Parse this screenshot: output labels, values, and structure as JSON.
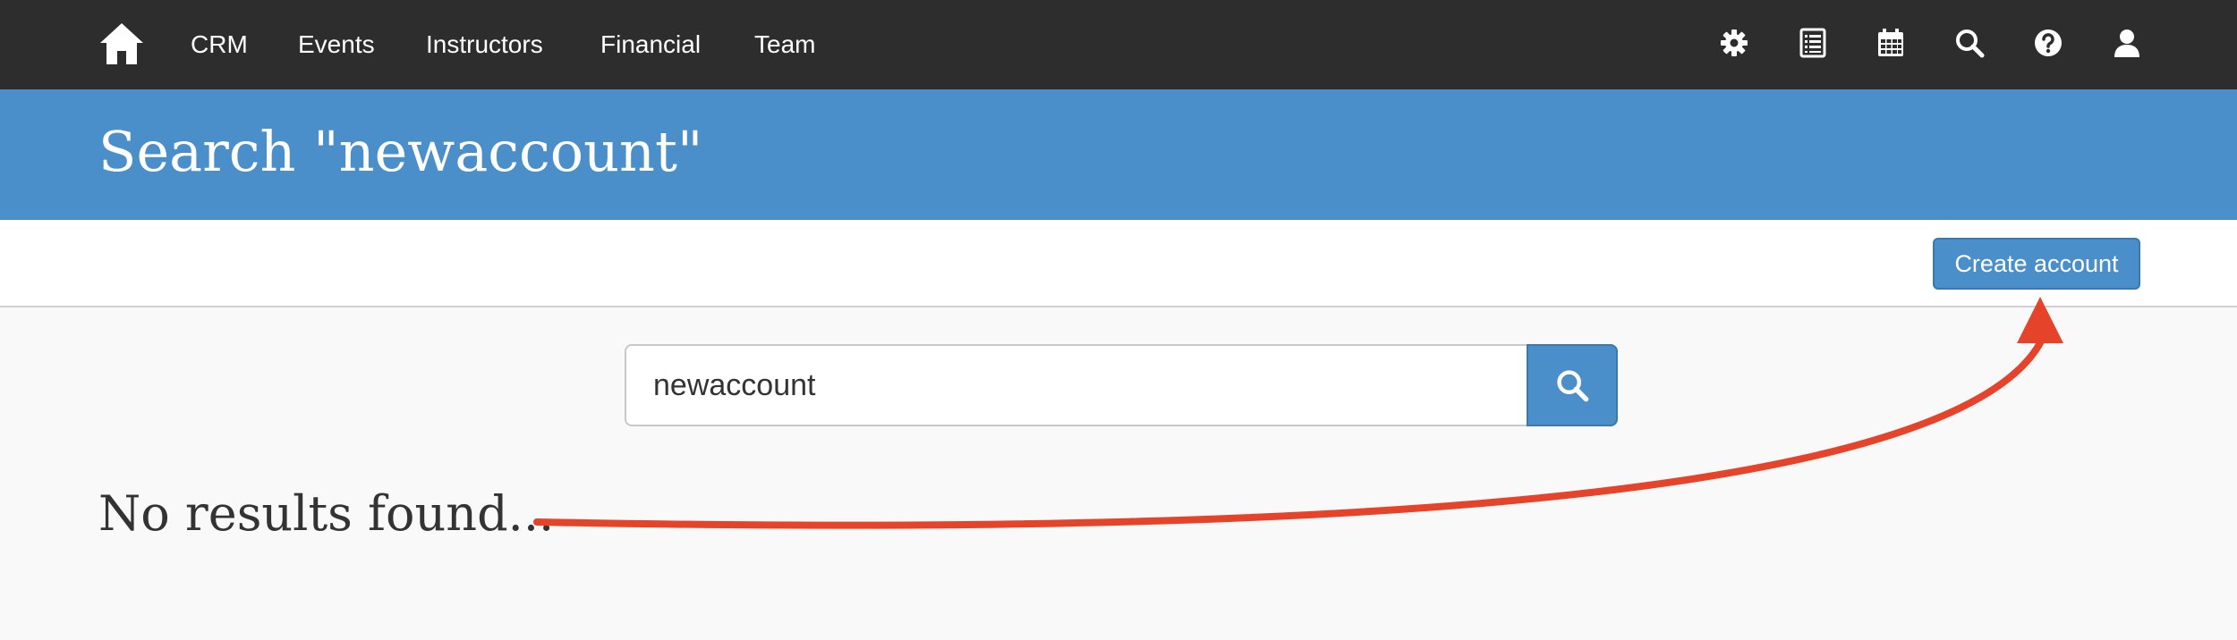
{
  "navbar": {
    "links": [
      {
        "label": "CRM"
      },
      {
        "label": "Events"
      },
      {
        "label": "Instructors"
      },
      {
        "label": "Financial"
      },
      {
        "label": "Team"
      }
    ],
    "icons": [
      "home-icon",
      "gear-icon",
      "list-icon",
      "calendar-icon",
      "search-icon",
      "help-icon",
      "user-icon"
    ]
  },
  "header": {
    "title": "Search \"newaccount\""
  },
  "toolbar": {
    "create_label": "Create account"
  },
  "search": {
    "value": "newaccount"
  },
  "results": {
    "empty_message": "No results found..."
  },
  "colors": {
    "navbar": "#2d2d2d",
    "header": "#4a8fca",
    "accent": "#4a8fca",
    "annotation": "#e5432a"
  }
}
